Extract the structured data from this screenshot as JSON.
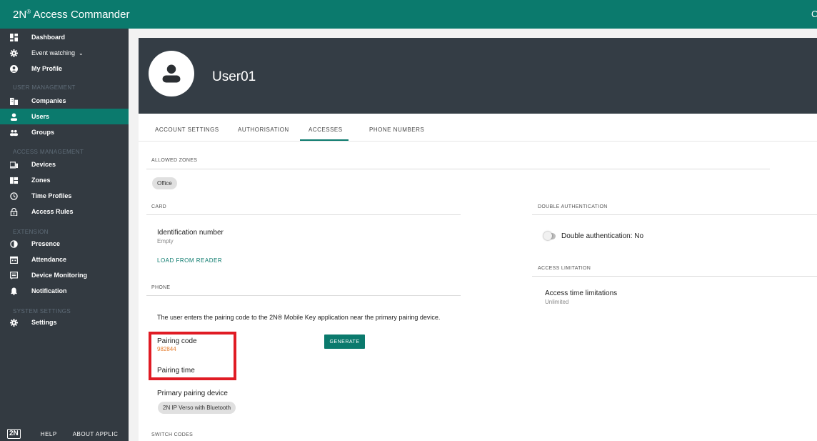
{
  "app": {
    "brand": "2N",
    "brand_sup": "®",
    "title": "Access Commander",
    "topbar_right": "C"
  },
  "sidebar": {
    "items": [
      {
        "label": "Dashboard",
        "icon": "dashboard-icon"
      },
      {
        "label": "Event watching",
        "icon": "gear-icon"
      },
      {
        "label": "My Profile",
        "icon": "profile-icon"
      },
      {
        "label": "Companies",
        "icon": "building-icon"
      },
      {
        "label": "Users",
        "icon": "user-icon"
      },
      {
        "label": "Groups",
        "icon": "group-icon"
      },
      {
        "label": "Devices",
        "icon": "device-icon"
      },
      {
        "label": "Zones",
        "icon": "zones-icon"
      },
      {
        "label": "Time Profiles",
        "icon": "clock-icon"
      },
      {
        "label": "Access Rules",
        "icon": "lock-icon"
      },
      {
        "label": "Presence",
        "icon": "presence-icon"
      },
      {
        "label": "Attendance",
        "icon": "calendar-icon"
      },
      {
        "label": "Device Monitoring",
        "icon": "monitoring-icon"
      },
      {
        "label": "Notification",
        "icon": "bell-icon"
      },
      {
        "label": "Settings",
        "icon": "settings-icon"
      }
    ],
    "sections": {
      "user_management": "USER MANAGEMENT",
      "access_management": "ACCESS MANAGEMENT",
      "extension": "EXTENSION",
      "system_settings": "SYSTEM SETTINGS"
    },
    "footer": {
      "logo": "2N",
      "help": "HELP",
      "about": "ABOUT APPLIC"
    }
  },
  "user": {
    "name": "User01"
  },
  "tabs": [
    "ACCOUNT SETTINGS",
    "AUTHORISATION",
    "ACCESSES",
    "PHONE NUMBERS"
  ],
  "accesses": {
    "allowed_zones_title": "ALLOWED ZONES",
    "zones": [
      "Office"
    ],
    "card": {
      "title": "CARD",
      "id_label": "Identification number",
      "id_value": "Empty",
      "load_button": "LOAD FROM READER"
    },
    "phone": {
      "title": "PHONE",
      "description": "The user enters the pairing code to the 2N® Mobile Key application near the primary pairing device.",
      "pairing_code_label": "Pairing code",
      "pairing_code_value": "982844",
      "generate_button": "GENERATE",
      "pairing_time_label": "Pairing time",
      "primary_device_label": "Primary pairing device",
      "primary_device_value": "2N IP Verso with Bluetooth"
    },
    "switch_codes_title": "SWITCH CODES",
    "double_auth": {
      "title": "DOUBLE AUTHENTICATION",
      "label": "Double authentication: No"
    },
    "access_limitation": {
      "title": "ACCESS LIMITATION",
      "label": "Access time limitations",
      "value": "Unlimited"
    }
  },
  "colors": {
    "accent": "#0b7a6d",
    "sidebar": "#333a41",
    "header": "#343d45",
    "highlight_box": "#e01b24",
    "pairing_code": "#e57a2a"
  }
}
